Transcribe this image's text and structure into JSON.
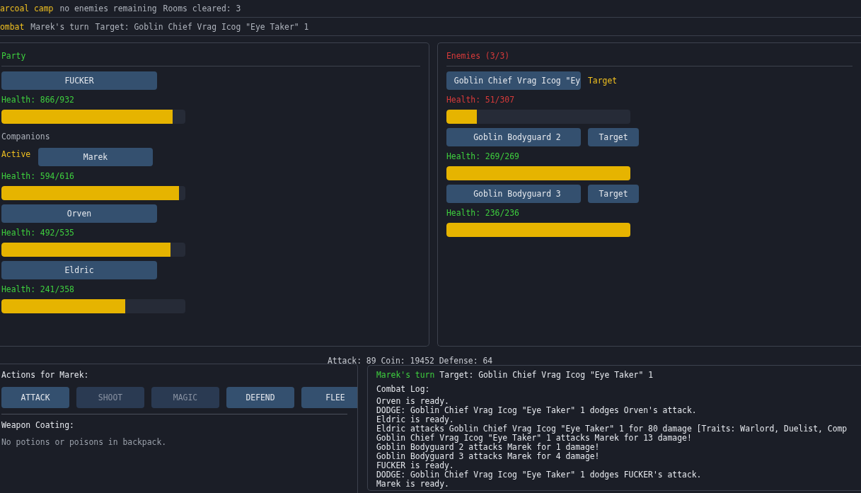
{
  "status_bar": {
    "location": "arcoal camp",
    "enemies": "no enemies remaining",
    "rooms": "Rooms cleared: 3"
  },
  "combat_bar": {
    "mode": "ombat",
    "turn": "Marek's turn",
    "target": "Target: Goblin Chief Vrag Icog \"Eye Taker\" 1"
  },
  "party": {
    "title": "Party",
    "player": {
      "name": "FUCKER",
      "health": "Health: 866/932",
      "level": 0.929
    },
    "companions_title": "Companions",
    "companions": [
      {
        "name": "Marek",
        "status": "Active",
        "health": "Health: 594/616",
        "level": 0.964
      },
      {
        "name": "Orven",
        "health": "Health: 492/535",
        "level": 0.92
      },
      {
        "name": "Eldric",
        "health": "Health: 241/358",
        "level": 0.673
      }
    ]
  },
  "enemies": {
    "title": "Enemies (3/3)",
    "items": [
      {
        "name": "Goblin Chief Vrag Icog \"Ey",
        "target": "Target",
        "selected": true,
        "critical": true,
        "health": "Health: 51/307",
        "level": 0.166
      },
      {
        "name": "Goblin Bodyguard 2",
        "target": "Target",
        "selected": false,
        "critical": false,
        "health": "Health: 269/269",
        "level": 1
      },
      {
        "name": "Goblin Bodyguard 3",
        "target": "Target",
        "selected": false,
        "critical": false,
        "health": "Health: 236/236",
        "level": 1
      }
    ]
  },
  "stats": {
    "line": "Attack: 89  Coin: 19452  Defense: 64"
  },
  "actions": {
    "title": "Actions for Marek:",
    "buttons": [
      {
        "label": "ATTACK",
        "disabled": false
      },
      {
        "label": "SHOOT",
        "disabled": true
      },
      {
        "label": "MAGIC",
        "disabled": true
      },
      {
        "label": "DEFEND",
        "disabled": false
      },
      {
        "label": "FLEE",
        "disabled": false
      }
    ],
    "coating_title": "Weapon Coating:",
    "coating_note": "No potions or poisons in backpack."
  },
  "log_window": {
    "turn": "Marek's turn",
    "target": "Target: Goblin Chief Vrag Icog \"Eye Taker\" 1",
    "title": "Combat Log:",
    "lines": [
      "Orven is ready.",
      "DODGE: Goblin Chief Vrag Icog \"Eye Taker\" 1 dodges Orven's attack.",
      "Eldric is ready.",
      "Eldric attacks Goblin Chief Vrag Icog \"Eye Taker\" 1 for 80 damage [Traits: Warlord, Duelist, Comp",
      "Goblin Chief Vrag Icog \"Eye Taker\" 1 attacks Marek for 13 damage!",
      "Goblin Bodyguard 2 attacks Marek for 1 damage!",
      "Goblin Bodyguard 3 attacks Marek for 4 damage!",
      "FUCKER is ready.",
      "DODGE: Goblin Chief Vrag Icog \"Eye Taker\" 1 dodges FUCKER's attack.",
      "Marek is ready."
    ]
  }
}
